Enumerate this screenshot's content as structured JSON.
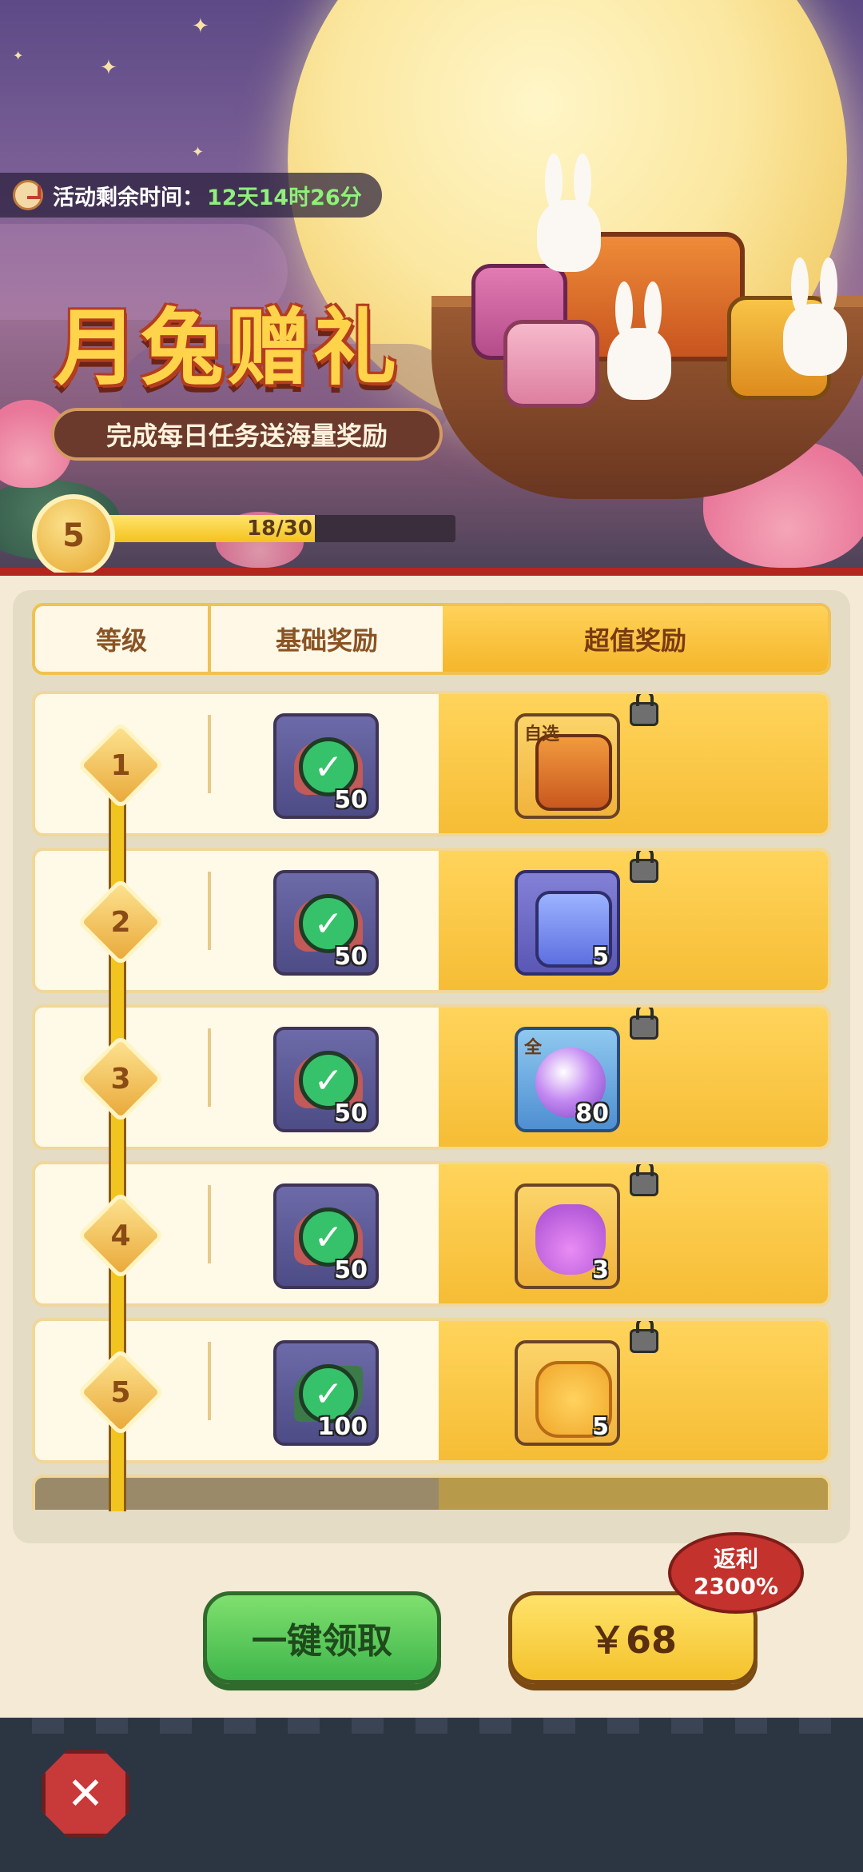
{
  "banner": {
    "timer_label": "活动剩余时间：",
    "timer_value": "12天14时26分",
    "title": "月兔赠礼",
    "subtitle": "完成每日任务送海量奖励",
    "level": "5",
    "progress_text": "18/30",
    "progress_fraction": 0.6
  },
  "table": {
    "col_level": "等级",
    "col_basic": "基础奖励",
    "col_premium": "超值奖励"
  },
  "rows": [
    {
      "level": "1",
      "basic_qty": "50",
      "basic_item": "lotus-icon",
      "premium_qty": "",
      "premium_tag": "自选",
      "premium_item": "treasure-chest-icon"
    },
    {
      "level": "2",
      "basic_qty": "50",
      "basic_item": "lotus-icon",
      "premium_qty": "5",
      "premium_tag": "",
      "premium_item": "ticket-icon"
    },
    {
      "level": "3",
      "basic_qty": "50",
      "basic_item": "lotus-icon",
      "premium_qty": "80",
      "premium_tag": "全",
      "premium_item": "crystal-orb-icon"
    },
    {
      "level": "4",
      "basic_qty": "50",
      "basic_item": "lotus-icon",
      "premium_qty": "3",
      "premium_tag": "",
      "premium_item": "potion-icon"
    },
    {
      "level": "5",
      "basic_qty": "100",
      "basic_item": "leaf-icon",
      "premium_qty": "5",
      "premium_tag": "",
      "premium_item": "mooncake-icon"
    }
  ],
  "buttons": {
    "claim_all": "一键领取",
    "price": "￥68",
    "rebate_line1": "返利",
    "rebate_line2": "2300%"
  },
  "colors": {
    "accent_gold": "#f5b62a",
    "claim_green": "#3fb64c",
    "close_red": "#c8393a"
  }
}
